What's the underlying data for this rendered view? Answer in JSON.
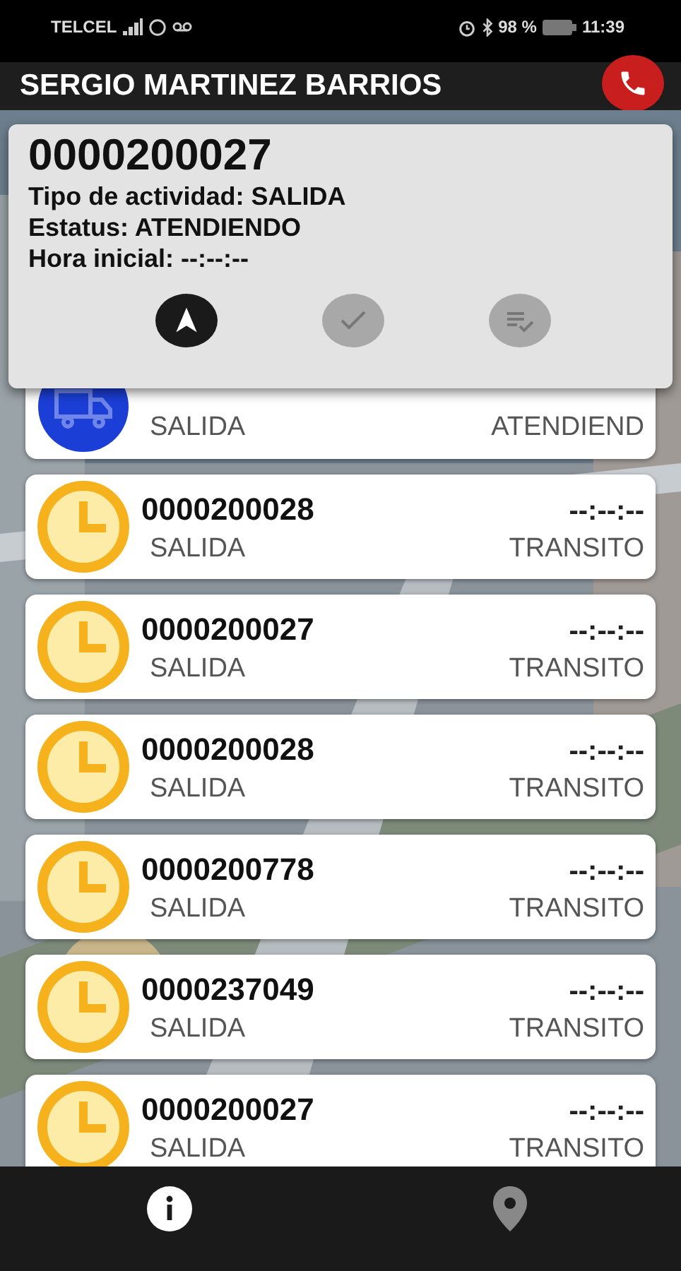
{
  "status_bar": {
    "carrier": "TELCEL",
    "battery": "98 %",
    "time": "11:39"
  },
  "header": {
    "title": "SERGIO MARTINEZ BARRIOS"
  },
  "detail": {
    "number": "0000200027",
    "lines": [
      "Tipo de actividad: SALIDA",
      "Estatus: ATENDIENDO",
      "Hora inicial: --:--:--"
    ],
    "actions": [
      {
        "kind": "navigate",
        "enabled": true
      },
      {
        "kind": "check",
        "enabled": false
      },
      {
        "kind": "checklist",
        "enabled": false
      }
    ]
  },
  "activities": [
    {
      "kind": "active",
      "type": "SALIDA",
      "status": "ATENDIEND"
    },
    {
      "kind": "pending",
      "number": "0000200028",
      "time": "--:--:--",
      "type": "SALIDA",
      "status": "TRANSITO"
    },
    {
      "kind": "pending",
      "number": "0000200027",
      "time": "--:--:--",
      "type": "SALIDA",
      "status": "TRANSITO"
    },
    {
      "kind": "pending",
      "number": "0000200028",
      "time": "--:--:--",
      "type": "SALIDA",
      "status": "TRANSITO"
    },
    {
      "kind": "pending",
      "number": "0000200778",
      "time": "--:--:--",
      "type": "SALIDA",
      "status": "TRANSITO"
    },
    {
      "kind": "pending",
      "number": "0000237049",
      "time": "--:--:--",
      "type": "SALIDA",
      "status": "TRANSITO"
    },
    {
      "kind": "pending",
      "number": "0000200027",
      "time": "--:--:--",
      "type": "SALIDA",
      "status": "TRANSITO"
    }
  ],
  "bottom_nav": [
    {
      "kind": "info",
      "selected": true
    },
    {
      "kind": "map",
      "selected": false
    }
  ]
}
